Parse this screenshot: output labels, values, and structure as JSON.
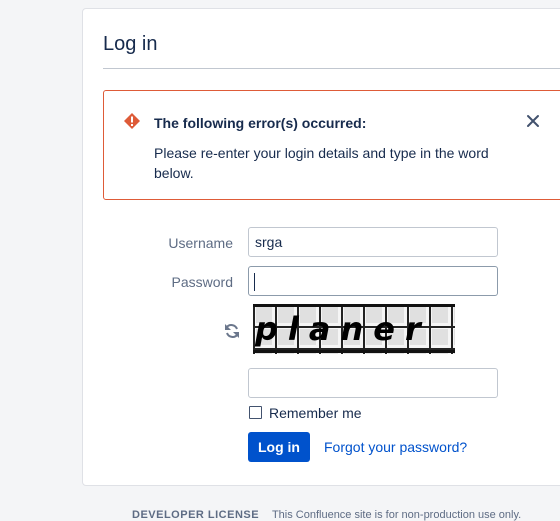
{
  "page": {
    "title": "Log in"
  },
  "error": {
    "title": "The following error(s) occurred:",
    "message": "Please re-enter your login details and type in the word below.",
    "icon": "error-icon",
    "close_icon": "close-icon",
    "accent": "#de5b38"
  },
  "form": {
    "username_label": "Username",
    "username_value": "srga",
    "password_label": "Password",
    "password_value": "",
    "captcha_word": "planer",
    "captcha_answer": "",
    "refresh_icon": "refresh-icon",
    "remember_label": "Remember me",
    "remember_checked": false,
    "login_button": "Log in",
    "forgot_link": "Forgot your password?"
  },
  "footer": {
    "license": "DEVELOPER LICENSE",
    "text": "This Confluence site is for non-production use only."
  },
  "colors": {
    "primary": "#0052cc",
    "text": "#172b4d",
    "muted": "#5e6c84",
    "background": "#f4f5f7"
  }
}
